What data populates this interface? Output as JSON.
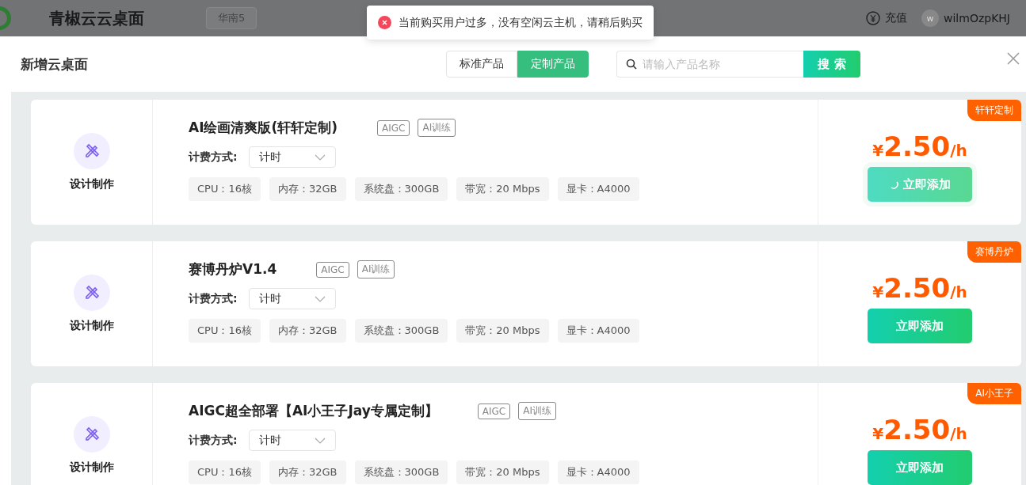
{
  "app_header": {
    "title": "青椒云云桌面",
    "region": "华南5",
    "recharge": "充值",
    "avatar_letter": "w",
    "username": "wilmOzpKHJ"
  },
  "toast": {
    "message": "当前购买用户过多，没有空闲云主机，请稍后购买"
  },
  "dialog": {
    "title": "新增云桌面",
    "tabs": [
      {
        "label": "标准产品",
        "selected": false
      },
      {
        "label": "定制产品",
        "selected": true
      }
    ],
    "search": {
      "placeholder": "请输入产品名称",
      "button": "搜 索"
    },
    "products": [
      {
        "category": "设计制作",
        "name": "AI绘画清爽版(轩轩定制)",
        "tags": [
          "AIGC",
          "AI训练"
        ],
        "billing_label": "计费方式:",
        "billing_value": "计时",
        "specs": [
          "CPU：16核",
          "内存：32GB",
          "系统盘：300GB",
          "带宽：20 Mbps",
          "显卡：A4000"
        ],
        "ribbon": "轩轩定制",
        "currency": "¥",
        "price": "2.50",
        "unit": "/h",
        "button": "立即添加",
        "loading": true
      },
      {
        "category": "设计制作",
        "name": "赛博丹炉V1.4",
        "tags": [
          "AIGC",
          "AI训练"
        ],
        "billing_label": "计费方式:",
        "billing_value": "计时",
        "specs": [
          "CPU：16核",
          "内存：32GB",
          "系统盘：300GB",
          "带宽：20 Mbps",
          "显卡：A4000"
        ],
        "ribbon": "赛博丹炉",
        "currency": "¥",
        "price": "2.50",
        "unit": "/h",
        "button": "立即添加",
        "loading": false
      },
      {
        "category": "设计制作",
        "name": "AIGC超全部署【AI小王子Jay专属定制】",
        "tags": [
          "AIGC",
          "AI训练"
        ],
        "billing_label": "计费方式:",
        "billing_value": "计时",
        "specs": [
          "CPU：16核",
          "内存：32GB",
          "系统盘：300GB",
          "带宽：20 Mbps",
          "显卡：A4000"
        ],
        "ribbon": "AI小王子",
        "currency": "¥",
        "price": "2.50",
        "unit": "/h",
        "button": "立即添加",
        "loading": false
      }
    ]
  }
}
